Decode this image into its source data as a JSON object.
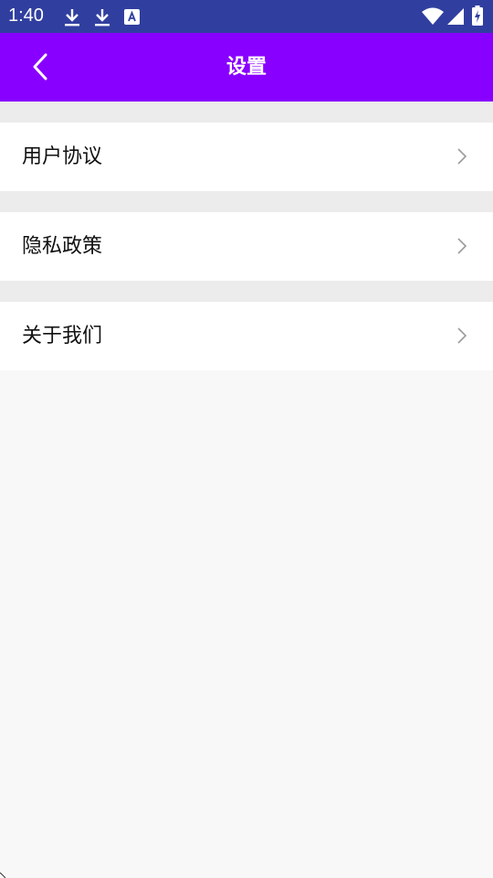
{
  "status_bar": {
    "time": "1:40",
    "left_icons": [
      "download-icon",
      "download-icon",
      "font-icon"
    ],
    "right_icons": [
      "wifi-icon",
      "cell-signal-icon",
      "battery-charging-icon"
    ]
  },
  "header": {
    "title": "设置",
    "back_icon": "chevron-left-icon",
    "background": "#8800ff"
  },
  "menu": {
    "items": [
      {
        "label": "用户协议",
        "icon": "chevron-right-icon"
      },
      {
        "label": "隐私政策",
        "icon": "chevron-right-icon"
      },
      {
        "label": "关于我们",
        "icon": "chevron-right-icon"
      }
    ]
  },
  "colors": {
    "status_bar": "#303f9f",
    "header": "#8800ff",
    "separator": "#ececec",
    "page_background": "#f8f8f8"
  }
}
